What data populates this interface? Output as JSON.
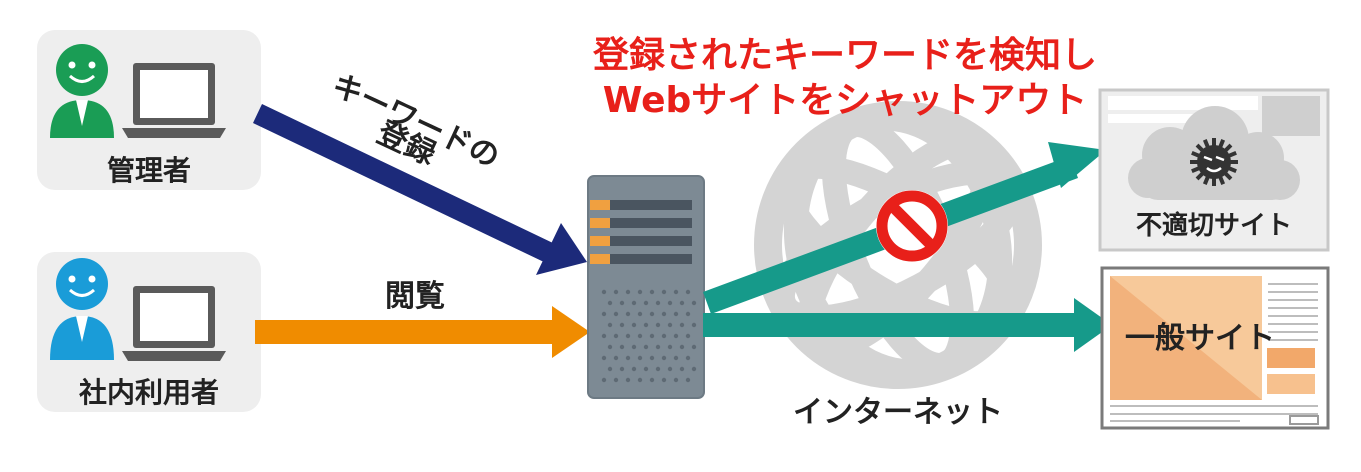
{
  "users": {
    "admin": {
      "label": "管理者",
      "person_color": "#1a9d55",
      "icon": "person-icon"
    },
    "employee": {
      "label": "社内利用者",
      "person_color": "#1a9cd8",
      "icon": "person-icon"
    }
  },
  "flows": {
    "register": {
      "label_line1": "キーワードの",
      "label_line2": "登録",
      "color": "#1c2a7a"
    },
    "browse": {
      "label": "閲覧",
      "color": "#f08c00"
    }
  },
  "headline": {
    "line1": "登録されたキーワードを検知し",
    "line2": "Webサイトをシャットアウト",
    "color": "#e8201a"
  },
  "internet": {
    "label": "インターネット"
  },
  "sites": {
    "bad": {
      "label": "不適切サイト",
      "icon": "virus-icon"
    },
    "general": {
      "label": "一般サイト"
    }
  },
  "block_icon": {
    "name": "prohibited-icon",
    "color": "#e8201a"
  },
  "arrow_color": "#169a8a"
}
